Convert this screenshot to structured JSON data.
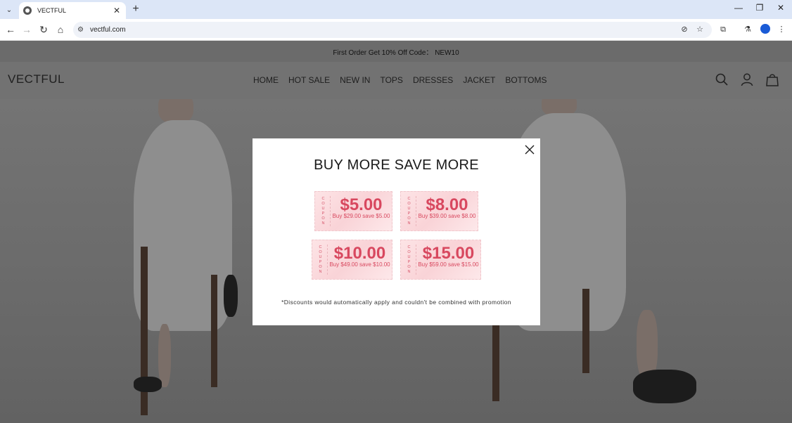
{
  "browser": {
    "tab_title": "VECTFUL",
    "url": "vectful.com"
  },
  "site": {
    "announcement": "First Order Get 10% Off Code： NEW10",
    "logo": "VECTFUL",
    "nav": [
      "HOME",
      "HOT SALE",
      "NEW IN",
      "TOPS",
      "DRESSES",
      "JACKET",
      "BOTTOMS"
    ]
  },
  "modal": {
    "title": "BUY MORE SAVE MORE",
    "coupon_label": [
      "C",
      "O",
      "U",
      "P",
      "O",
      "N"
    ],
    "coupons": [
      {
        "amount": "$5.00",
        "condition": "Buy $29.00 save $5.00"
      },
      {
        "amount": "$8.00",
        "condition": "Buy $39.00 save $8.00"
      },
      {
        "amount": "$10.00",
        "condition": "Buy $49.00 save $10.00"
      },
      {
        "amount": "$15.00",
        "condition": "Buy $59.00 save $15.00"
      }
    ],
    "disclaimer": "*Discounts would automatically apply and couldn't be combined with promotion"
  },
  "colors": {
    "coupon_text": "#d8485f",
    "overlay": "#6e6e6e"
  }
}
